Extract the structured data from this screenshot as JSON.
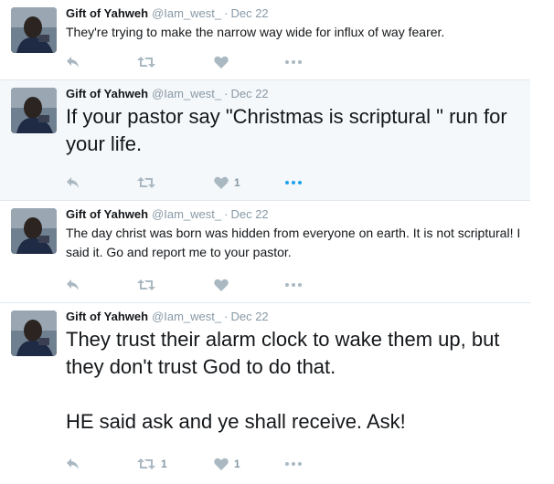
{
  "tweets": [
    {
      "name": "Gift of Yahweh",
      "handle": "@Iam_west_",
      "dot": "·",
      "date": "Dec 22",
      "text": "They're trying to make the narrow way wide for influx of way fearer.",
      "retweets": "",
      "likes": ""
    },
    {
      "name": "Gift of Yahweh",
      "handle": "@Iam_west_",
      "dot": "·",
      "date": "Dec 22",
      "text": "If your pastor say \"Christmas is scriptural \" run for your life.",
      "retweets": "",
      "likes": "1"
    },
    {
      "name": "Gift of Yahweh",
      "handle": "@Iam_west_",
      "dot": "·",
      "date": "Dec 22",
      "text": "The day christ was born was hidden from everyone on earth. It is not scriptural! I said it. Go and report me to your pastor.",
      "retweets": "",
      "likes": ""
    },
    {
      "name": "Gift of Yahweh",
      "handle": "@Iam_west_",
      "dot": "·",
      "date": "Dec 22",
      "text": "They trust their alarm clock to wake them up, but they don't trust God to do that.",
      "text2": "HE said ask and ye shall receive. Ask!",
      "retweets": "1",
      "likes": "1"
    }
  ],
  "icons": {
    "reply": "reply-icon",
    "retweet": "retweet-icon",
    "like": "heart-icon",
    "more": "more-icon"
  }
}
